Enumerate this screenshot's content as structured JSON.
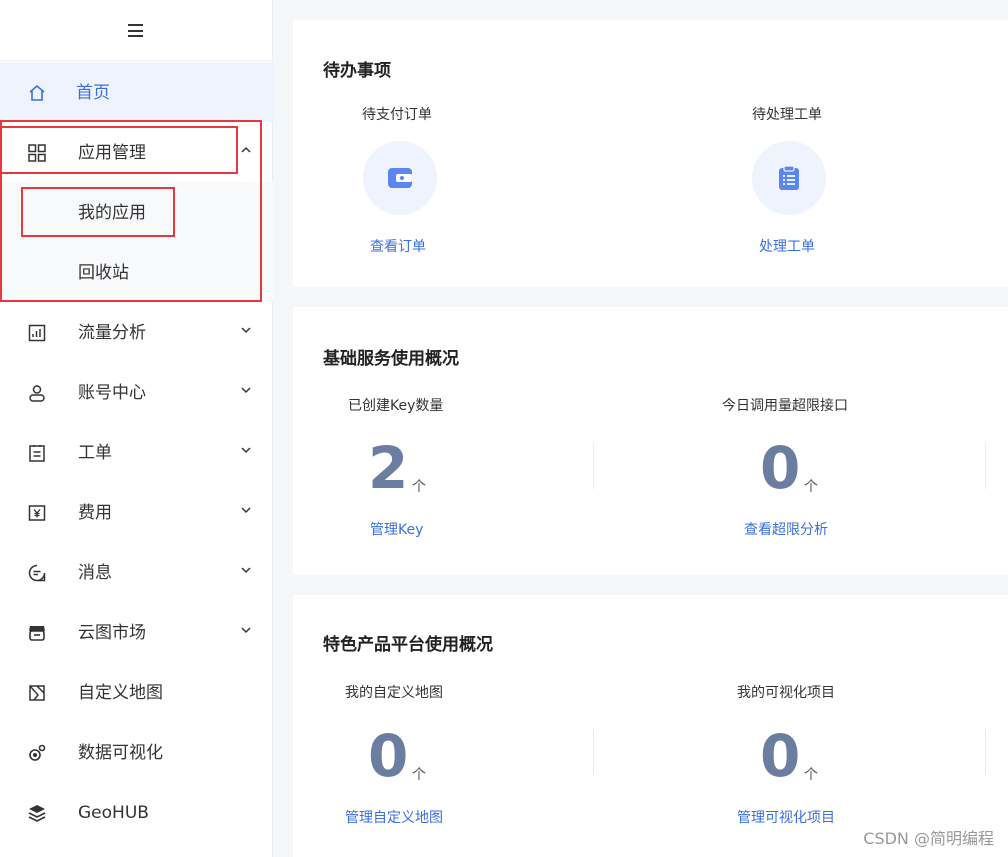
{
  "sidebar": {
    "items": [
      {
        "label": "首页",
        "icon": "home-icon"
      },
      {
        "label": "应用管理",
        "icon": "grid-icon"
      },
      {
        "label": "我的应用"
      },
      {
        "label": "回收站"
      },
      {
        "label": "流量分析",
        "icon": "chart-icon"
      },
      {
        "label": "账号中心",
        "icon": "user-icon"
      },
      {
        "label": "工单",
        "icon": "clipboard-icon"
      },
      {
        "label": "费用",
        "icon": "yen-icon"
      },
      {
        "label": "消息",
        "icon": "message-icon"
      },
      {
        "label": "云图市场",
        "icon": "store-icon"
      },
      {
        "label": "自定义地图",
        "icon": "map-icon"
      },
      {
        "label": "数据可视化",
        "icon": "visual-icon"
      },
      {
        "label": "GeoHUB",
        "icon": "layers-icon"
      }
    ]
  },
  "todo": {
    "title": "待办事项",
    "items": [
      {
        "label": "待支付订单",
        "link": "查看订单",
        "icon": "wallet-icon"
      },
      {
        "label": "待处理工单",
        "link": "处理工单",
        "icon": "clipboard-list-icon"
      }
    ]
  },
  "basic": {
    "title": "基础服务使用概况",
    "stats": [
      {
        "label": "已创建Key数量",
        "value": "2",
        "unit": "个",
        "link": "管理Key"
      },
      {
        "label": "今日调用量超限接口",
        "value": "0",
        "unit": "个",
        "link": "查看超限分析"
      }
    ]
  },
  "featured": {
    "title": "特色产品平台使用概况",
    "stats": [
      {
        "label": "我的自定义地图",
        "value": "0",
        "unit": "个",
        "link": "管理自定义地图"
      },
      {
        "label": "我的可视化项目",
        "value": "0",
        "unit": "个",
        "link": "管理可视化项目"
      }
    ]
  },
  "watermark": "CSDN @简明编程",
  "colors": {
    "accent": "#3a6fe0",
    "highlight": "#e8383d",
    "number": "#6b7da0"
  }
}
